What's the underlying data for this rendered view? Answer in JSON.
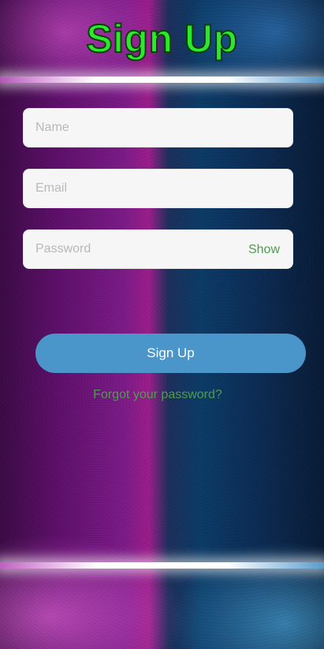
{
  "header": {
    "title": "Sign Up"
  },
  "form": {
    "name_placeholder": "Name",
    "email_placeholder": "Email",
    "password_placeholder": "Password",
    "show_label": "Show",
    "submit_label": "Sign Up",
    "forgot_label": "Forgot your password?"
  },
  "colors": {
    "title": "#2ee82e",
    "button": "#4a95c9",
    "link": "#4f9d4f",
    "field_bg": "#f6f6f6"
  }
}
